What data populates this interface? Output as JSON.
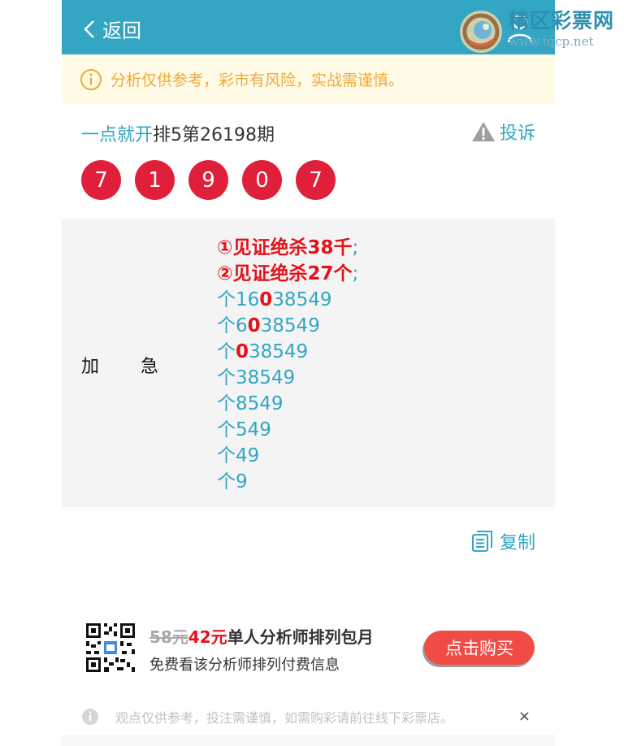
{
  "header": {
    "back_label": "返回",
    "logo_text": "精区彩票网",
    "logo_url": "www.tqcp.net"
  },
  "notice": {
    "text": "分析仅供参考，彩市有风险，实战需谨慎。"
  },
  "issue": {
    "analyst": "一点就开",
    "title_rest": "排5第26198期",
    "complain_label": "投诉"
  },
  "balls": [
    "7",
    "1",
    "9",
    "0",
    "7"
  ],
  "panel": {
    "label_a": "加",
    "label_b": "急",
    "claims": [
      {
        "text": "①见证绝杀38千",
        "suffix": ";"
      },
      {
        "text": "②见证绝杀27个",
        "suffix": ";"
      }
    ],
    "lines": [
      {
        "pre": "个16",
        "hl": "0",
        "post": "38549"
      },
      {
        "pre": "个6",
        "hl": "0",
        "post": "38549"
      },
      {
        "pre": "个",
        "hl": "0",
        "post": "38549"
      },
      {
        "pre": "个38549",
        "hl": "",
        "post": ""
      },
      {
        "pre": "个8549",
        "hl": "",
        "post": ""
      },
      {
        "pre": "个549",
        "hl": "",
        "post": ""
      },
      {
        "pre": "个49",
        "hl": "",
        "post": ""
      },
      {
        "pre": "个9",
        "hl": "",
        "post": ""
      }
    ]
  },
  "copy_label": "复制",
  "promo": {
    "old_price": "58元",
    "new_price": "42元",
    "title": "单人分析师排列包月",
    "subtitle": "免费看该分析师排列付费信息",
    "buy_label": "点击购买"
  },
  "footer": {
    "text": "观点仅供参考，投注需谨慎，如需购彩请前往线下彩票店。",
    "close_label": "×"
  },
  "colors": {
    "header_bg": "#32a6c3",
    "ball_red": "#e0203a",
    "highlight_red": "#e3121b",
    "notice_text": "#f0a93a",
    "buy_button": "#f04b45"
  }
}
